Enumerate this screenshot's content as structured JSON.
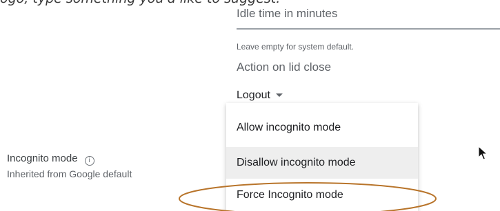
{
  "caption": "ogo, type something you'd like to suggest.",
  "idle": {
    "label": "Idle time in minutes",
    "helper": "Leave empty for system default."
  },
  "lid_close": {
    "label": "Action on lid close",
    "selected": "Logout"
  },
  "incognito_menu": {
    "options": [
      "Allow incognito mode",
      "Disallow incognito mode",
      "Force Incognito mode"
    ],
    "highlighted_option": "Disallow incognito mode",
    "circled_option": "Force Incognito mode"
  },
  "incognito": {
    "title": "Incognito mode",
    "info_glyph": "i",
    "subtitle": "Inherited from Google default"
  },
  "colors": {
    "annotation_circle": "#b8742a",
    "menu_hover": "#eeeeee",
    "underline": "#9aa0a6"
  }
}
